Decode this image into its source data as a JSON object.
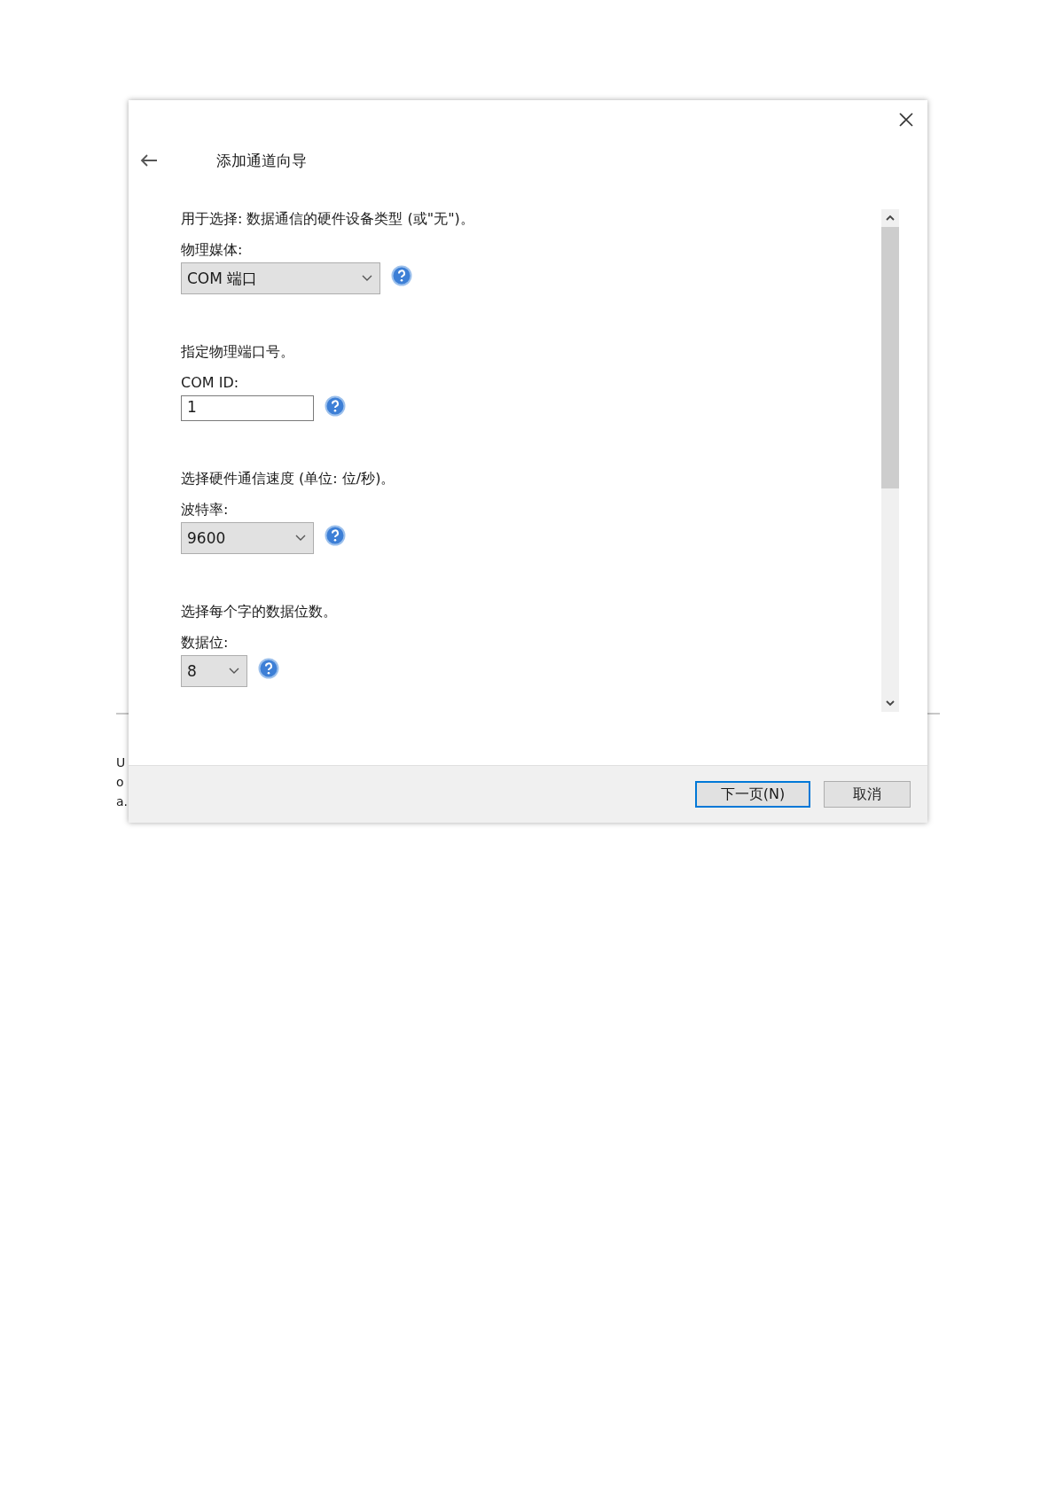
{
  "background_window": {
    "fragments": [
      "U",
      "o",
      "a."
    ]
  },
  "dialog": {
    "title": "添加通道向导",
    "sections": [
      {
        "description": "用于选择: 数据通信的硬件设备类型 (或\"无\")。",
        "label": "物理媒体:",
        "kind": "dropdown",
        "value": "COM 端口"
      },
      {
        "description": "指定物理端口号。",
        "label": "COM ID:",
        "kind": "text",
        "value": "1"
      },
      {
        "description": "选择硬件通信速度 (单位: 位/秒)。",
        "label": "波特率:",
        "kind": "dropdown",
        "value": "9600"
      },
      {
        "description": "选择每个字的数据位数。",
        "label": "数据位:",
        "kind": "dropdown",
        "value": "8"
      }
    ],
    "buttons": [
      {
        "label": "下一页(N)",
        "selected": true
      },
      {
        "label": "取消",
        "selected": false
      }
    ]
  }
}
